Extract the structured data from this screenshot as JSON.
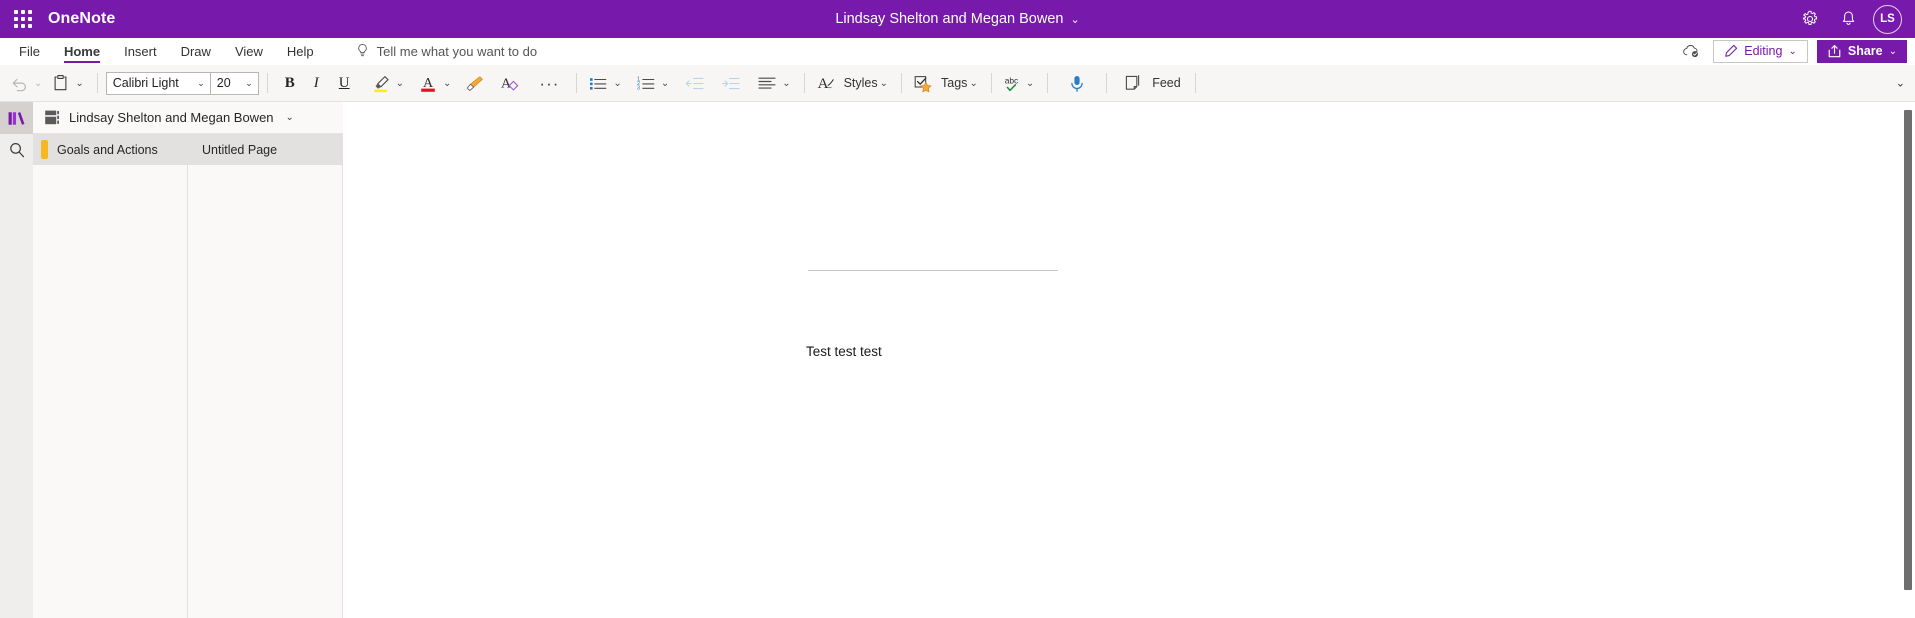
{
  "titlebar": {
    "waffle_label": "app-launcher",
    "app_name": "OneNote",
    "document_title": "Lindsay Shelton and Megan Bowen",
    "chevron": "⌄",
    "settings_icon": "gear-icon",
    "notifications_icon": "bell-icon",
    "avatar_initials": "LS",
    "brand_color": "#7719aa"
  },
  "menubar": {
    "tabs": [
      {
        "label": "File",
        "active": false
      },
      {
        "label": "Home",
        "active": true
      },
      {
        "label": "Insert",
        "active": false
      },
      {
        "label": "Draw",
        "active": false
      },
      {
        "label": "View",
        "active": false
      },
      {
        "label": "Help",
        "active": false
      }
    ],
    "tell_me": "Tell me what you want to do",
    "tell_me_icon": "lightbulb-icon",
    "cloud_icon": "cloud-saved-icon",
    "editing_label": "Editing",
    "editing_chevron": "⌄",
    "share_label": "Share",
    "share_chevron": "⌄"
  },
  "ribbon": {
    "undo_icon": "undo-arrow-icon",
    "undo_chevron": "⌄",
    "paste_icon": "clipboard-paste-icon",
    "paste_chevron": "⌄",
    "font_name": "Calibri Light",
    "font_size": "20",
    "dropdown_chevron": "⌄",
    "bold_label": "B",
    "italic_label": "I",
    "underline_label": "U",
    "highlight_icon": "highlighter-pen-icon",
    "highlight_chevron": "⌄",
    "fontcolor_icon": "font-color-icon",
    "fontcolor_letter": "A",
    "fontcolor_chevron": "⌄",
    "format_painter_icon": "format-painter-icon",
    "clear_format_icon": "clear-formatting-icon",
    "clear_format_letter": "A",
    "more_icon": "ellipsis-icon",
    "bullets_icon": "bulleted-list-icon",
    "bullets_chevron": "⌄",
    "numbering_icon": "numbered-list-icon",
    "numbering_chevron": "⌄",
    "decrease_indent_icon": "decrease-indent-icon",
    "increase_indent_icon": "increase-indent-icon",
    "align_icon": "align-text-icon",
    "align_chevron": "⌄",
    "styles_icon": "styles-pen-icon",
    "styles_label": "Styles",
    "styles_chevron": "⌄",
    "tags_icon": "tags-star-icon",
    "tags_label": "Tags",
    "tags_chevron": "⌄",
    "spelling_icon": "spelling-check-icon",
    "spelling_label": "abc",
    "spelling_chevron": "⌄",
    "dictate_icon": "microphone-icon",
    "feed_icon": "feed-page-icon",
    "feed_label": "Feed",
    "collapse_chevron": "⌄",
    "highlight_color": "#ffee00",
    "fontcolor_color": "#e81123"
  },
  "rail": {
    "notebooks_icon": "notebooks-icon",
    "search_icon": "search-icon"
  },
  "nav": {
    "notebook_icon": "notebook-icon",
    "notebook_name": "Lindsay Shelton and Megan Bowen",
    "notebook_chevron": "⌄",
    "sections": [
      {
        "label": "Goals and Actions",
        "color": "#f5b820",
        "selected": true
      }
    ],
    "pages": [
      {
        "label": "Untitled Page",
        "selected": true
      }
    ]
  },
  "canvas": {
    "page_title": "",
    "page_body": "Test test test"
  }
}
